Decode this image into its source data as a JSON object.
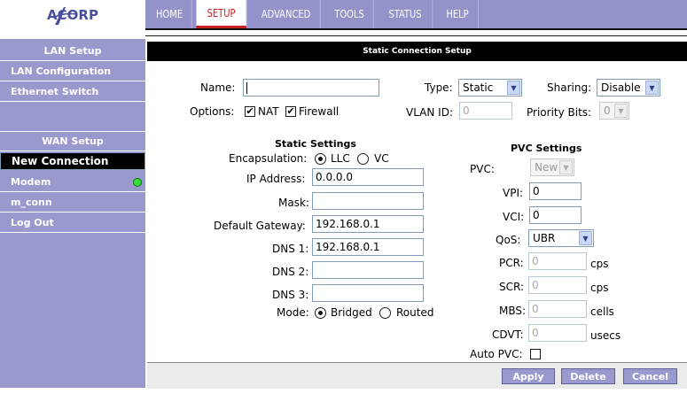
{
  "brand": {
    "logo_text": "ACORP"
  },
  "nav": {
    "tabs": [
      {
        "label": "HOME"
      },
      {
        "label": "SETUP"
      },
      {
        "label": "ADVANCED"
      },
      {
        "label": "TOOLS"
      },
      {
        "label": "STATUS"
      },
      {
        "label": "HELP"
      }
    ],
    "active_tab": "SETUP"
  },
  "sidebar": {
    "items": [
      {
        "label": "LAN Setup"
      },
      {
        "label": "LAN Configuration"
      },
      {
        "label": "Ethernet Switch"
      },
      {
        "label": ""
      },
      {
        "label": "WAN Setup"
      },
      {
        "label": "New Connection"
      },
      {
        "label": "Modem"
      },
      {
        "label": "m_conn"
      },
      {
        "label": "Log Out"
      }
    ],
    "modem_status_color": "#33dd33"
  },
  "page": {
    "title": "Static Connection Setup"
  },
  "form": {
    "name_label": "Name:",
    "name_value": "",
    "type_label": "Type:",
    "type_value": "Static",
    "sharing_label": "Sharing:",
    "sharing_value": "Disable",
    "options_label": "Options:",
    "nat_label": "NAT",
    "nat_checked": true,
    "firewall_label": "Firewall",
    "firewall_checked": true,
    "vlan_label": "VLAN ID:",
    "vlan_value": "0",
    "priority_label": "Priority Bits:",
    "priority_value": "0"
  },
  "static_settings": {
    "title": "Static Settings",
    "encapsulation_label": "Encapsulation:",
    "encap_llc": "LLC",
    "encap_vc": "VC",
    "encap_selected": "LLC",
    "ip_label": "IP Address:",
    "ip_value": "0.0.0.0",
    "mask_label": "Mask:",
    "mask_value": "",
    "gateway_label": "Default Gateway:",
    "gateway_value": "192.168.0.1",
    "dns1_label": "DNS 1:",
    "dns1_value": "192.168.0.1",
    "dns2_label": "DNS 2:",
    "dns2_value": "",
    "dns3_label": "DNS 3:",
    "dns3_value": "",
    "mode_label": "Mode:",
    "mode_bridged": "Bridged",
    "mode_routed": "Routed",
    "mode_selected": "Bridged"
  },
  "pvc_settings": {
    "title": "PVC Settings",
    "pvc_label": "PVC:",
    "pvc_value": "New",
    "vpi_label": "VPI:",
    "vpi_value": "0",
    "vci_label": "VCI:",
    "vci_value": "0",
    "qos_label": "QoS:",
    "qos_value": "UBR",
    "pcr_label": "PCR:",
    "pcr_value": "0",
    "pcr_unit": "cps",
    "scr_label": "SCR:",
    "scr_value": "0",
    "scr_unit": "cps",
    "mbs_label": "MBS:",
    "mbs_value": "0",
    "mbs_unit": "cells",
    "cdvt_label": "CDVT:",
    "cdvt_value": "0",
    "cdvt_unit": "usecs",
    "auto_pvc_label": "Auto PVC:",
    "auto_pvc_checked": false
  },
  "buttons": {
    "apply": "Apply",
    "delete": "Delete",
    "cancel": "Cancel"
  }
}
